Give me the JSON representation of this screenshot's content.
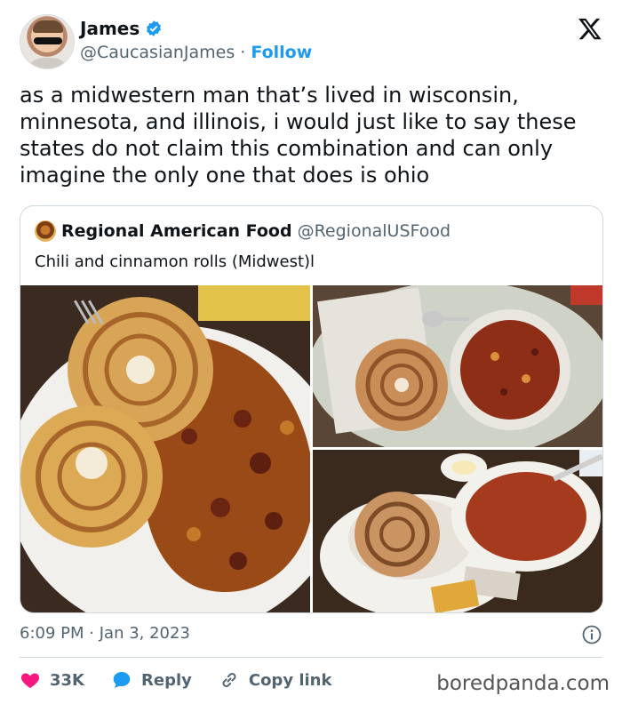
{
  "tweet": {
    "author_name": "James",
    "author_handle": "@CaucasianJames",
    "separator": "·",
    "follow_label": "Follow",
    "text": "as a midwestern man that’s lived in wisconsin, minnesota, and illinois, i would just like to say these states do not claim this combination and can only imagine the only one that does is ohio",
    "time": "6:09 PM",
    "date": "Jan 3, 2023",
    "time_date_separator": "·"
  },
  "quoted_tweet": {
    "author_name": "Regional American Food",
    "author_handle": "@RegionalUSFood",
    "text": "Chili and cinnamon rolls (Midwest)l"
  },
  "actions": {
    "like_count": "33K",
    "reply_label": "Reply",
    "copy_link_label": "Copy link"
  },
  "watermark": "boredpanda.com",
  "colors": {
    "accent": "#1d9bf0",
    "like": "#f91880",
    "text": "#0f1419",
    "muted": "#536471",
    "border": "#cfd9de"
  },
  "icons": {
    "verified": "verified-badge-icon",
    "brand": "x-logo-icon",
    "info": "info-icon",
    "like": "heart-icon",
    "reply": "speech-bubble-icon",
    "copy_link": "link-icon"
  }
}
